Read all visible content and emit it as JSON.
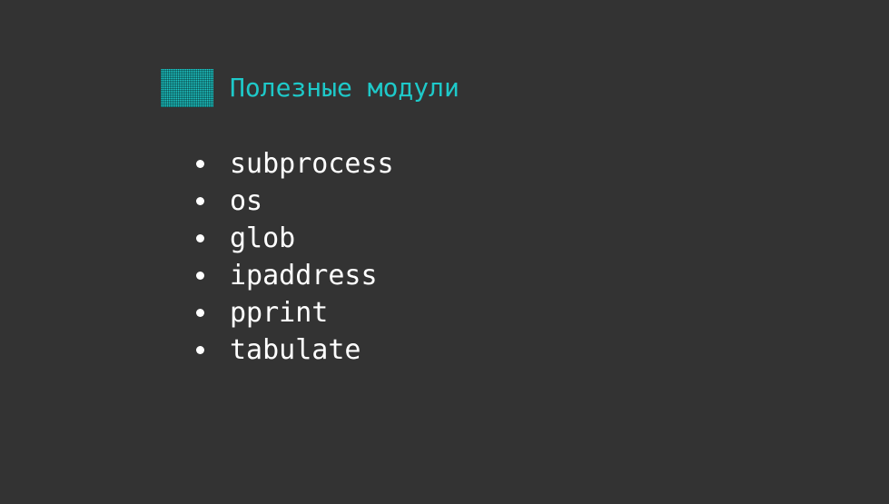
{
  "slide": {
    "heading": "Полезные модули",
    "heading_color": "#1ec9c9",
    "background_color": "#333333",
    "text_color": "#ffffff",
    "modules": [
      "subprocess",
      "os",
      "glob",
      "ipaddress",
      "pprint",
      "tabulate"
    ]
  }
}
